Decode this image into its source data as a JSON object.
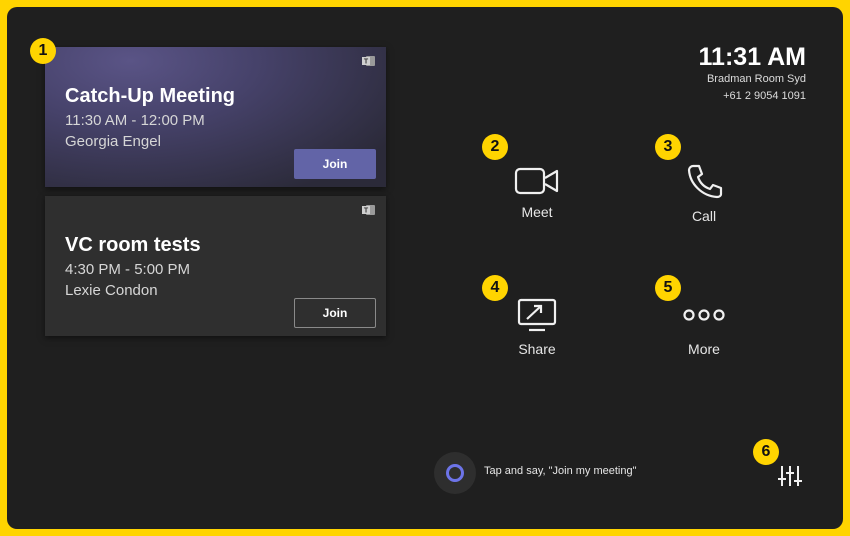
{
  "meetings": [
    {
      "title": "Catch-Up Meeting",
      "time": "11:30 AM - 12:00 PM",
      "organizer": "Georgia Engel",
      "join_label": "Join"
    },
    {
      "title": "VC room tests",
      "time": "4:30 PM - 5:00 PM",
      "organizer": "Lexie Condon",
      "join_label": "Join"
    }
  ],
  "clock": {
    "time": "11:31 AM",
    "room": "Bradman Room Syd",
    "phone": "+61 2 9054 1091"
  },
  "actions": {
    "meet": "Meet",
    "call": "Call",
    "share": "Share",
    "more": "More"
  },
  "cortana": {
    "hint": "Tap and say, \"Join my meeting\""
  },
  "callouts": [
    "1",
    "2",
    "3",
    "4",
    "5",
    "6"
  ],
  "colors": {
    "frame": "#ffd400",
    "background": "#1f1f1f",
    "accent": "#6264a7",
    "cortana": "#6d74e8"
  }
}
